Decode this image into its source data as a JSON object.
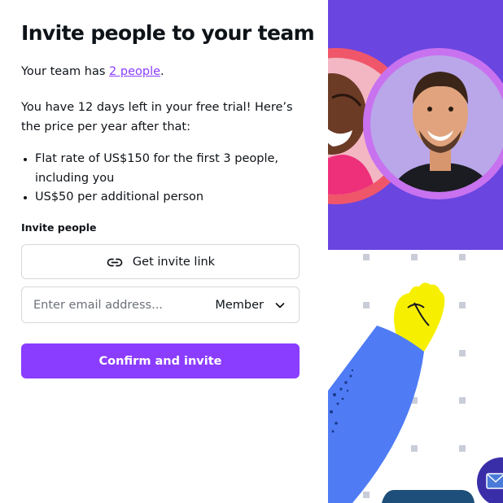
{
  "dialog": {
    "title": "Invite people to your team",
    "team_prefix": "Your team has ",
    "team_link": "2 people",
    "team_suffix": ".",
    "trial_text": "You have 12 days left in your free trial! Here’s the price per year after that:",
    "price_items": [
      "Flat rate of US$150 for the first 3 people, including you",
      "US$50 per additional person"
    ],
    "invite_label": "Invite people",
    "invite_link_button": "Get invite link",
    "email_placeholder": "Enter email address...",
    "role_value": "Member",
    "confirm_button": "Confirm and invite"
  },
  "colors": {
    "accent": "#8b3dff",
    "illustration_bg": "#6a45e0",
    "ring_red": "#f0566a",
    "ring_pink": "#c872f0",
    "sleeve_blue": "#4f7cf5",
    "hand_yellow": "#f6f000",
    "dots": "#c8cdd8",
    "chat_bubble": "#3a2ea8"
  },
  "icons": {
    "link": "link-icon",
    "chevron": "chevron-down-icon",
    "mail": "mail-icon"
  }
}
